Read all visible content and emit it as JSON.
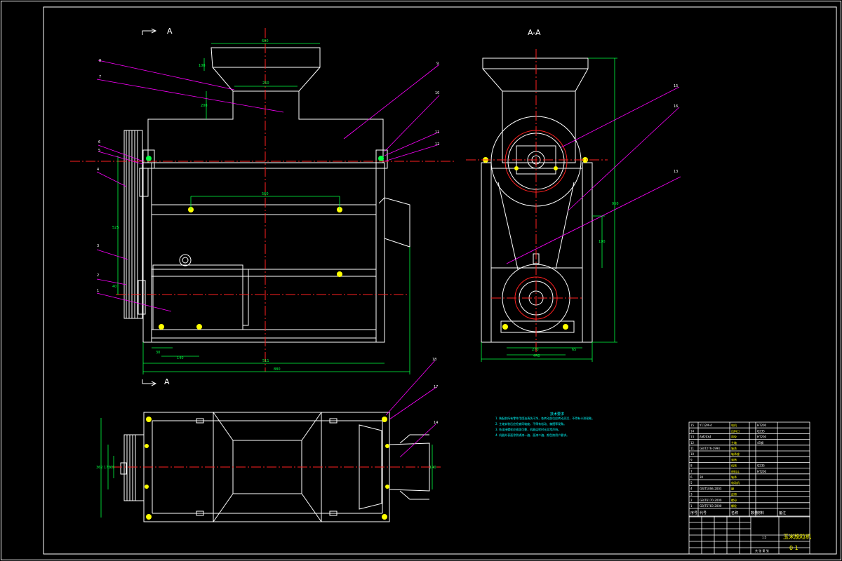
{
  "section_markers": {
    "top": "A",
    "bottom": "A"
  },
  "section_view_title": "A-A",
  "dimensions": {
    "hopper_top_width": "600",
    "hopper_height": "100",
    "throat_width": "250",
    "throat_height": "200",
    "bolt_spacing": "560",
    "vertical_pulley_span": "525",
    "pulley_offset": "40",
    "foot_offset_1": "30",
    "foot_offset_2": "140",
    "inner_length": "511",
    "overall_length": "880",
    "side_total_height": "950",
    "side_mid_height": "190",
    "side_base_1": "270",
    "side_base_2": "65",
    "side_base_total": "440",
    "plan_width_outer": "362",
    "plan_width_mid": "175",
    "plan_width_inner": "65",
    "plan_outlet_width": "140"
  },
  "part_numbers": [
    "1",
    "2",
    "3",
    "4",
    "5",
    "6",
    "7",
    "8",
    "9",
    "10",
    "11",
    "12",
    "13",
    "14",
    "15",
    "16",
    "17",
    "18"
  ],
  "tech_requirements": {
    "title": "技术要求",
    "lines": [
      "1. 装配前所有零件用煤油清洗干净，各转动部位应转动灵活，不得有卡滞现象。",
      "2. 主轴安装后应检查同轴度，不得有松动、偏摆等现象。",
      "3. 各连接螺栓应紧固可靠，机器运转时无异常声响。",
      "4. 机器外表面涂防锈漆一遍，面漆二遍，颜色按用户要求。"
    ]
  },
  "bom_rows": [
    [
      "1",
      "GB/T5783-2000",
      "螺栓",
      "",
      "",
      ""
    ],
    [
      "2",
      "GB/T6170-2000",
      "螺母",
      "",
      "",
      ""
    ],
    [
      "3",
      "",
      "皮带",
      "",
      "",
      ""
    ],
    [
      "4",
      "GB/T1096-2003",
      "键",
      "",
      "",
      ""
    ],
    [
      "5",
      "",
      "电动机",
      "",
      "",
      ""
    ],
    [
      "6",
      "30",
      "轴承",
      "",
      "",
      ""
    ],
    [
      "7",
      "",
      "进料斗",
      "",
      "HT200",
      ""
    ],
    [
      "8",
      "",
      "机壳",
      "",
      "Q235",
      ""
    ],
    [
      "9",
      "",
      "滚筒",
      "",
      "",
      ""
    ],
    [
      "10",
      "",
      "轴承座",
      "",
      "",
      ""
    ],
    [
      "11",
      "GB/T276-1994",
      "轴承",
      "",
      "",
      ""
    ],
    [
      "12",
      "",
      "主轴",
      "",
      "45钢",
      ""
    ],
    [
      "13",
      "AM20X4",
      "带轮",
      "",
      "HT200",
      ""
    ],
    [
      "14",
      "",
      "出料口",
      "",
      "Q235",
      ""
    ],
    [
      "15",
      "Y112M-4",
      "电机",
      "",
      "HT200",
      ""
    ]
  ],
  "bom_header": [
    "序号",
    "代号",
    "名称",
    "数量",
    "材料",
    "备注"
  ],
  "title_block": {
    "drawing_name": "玉米脱粒机",
    "drawing_number": "0 1",
    "scale": "1:5",
    "sheet": "共 张 第 张"
  }
}
